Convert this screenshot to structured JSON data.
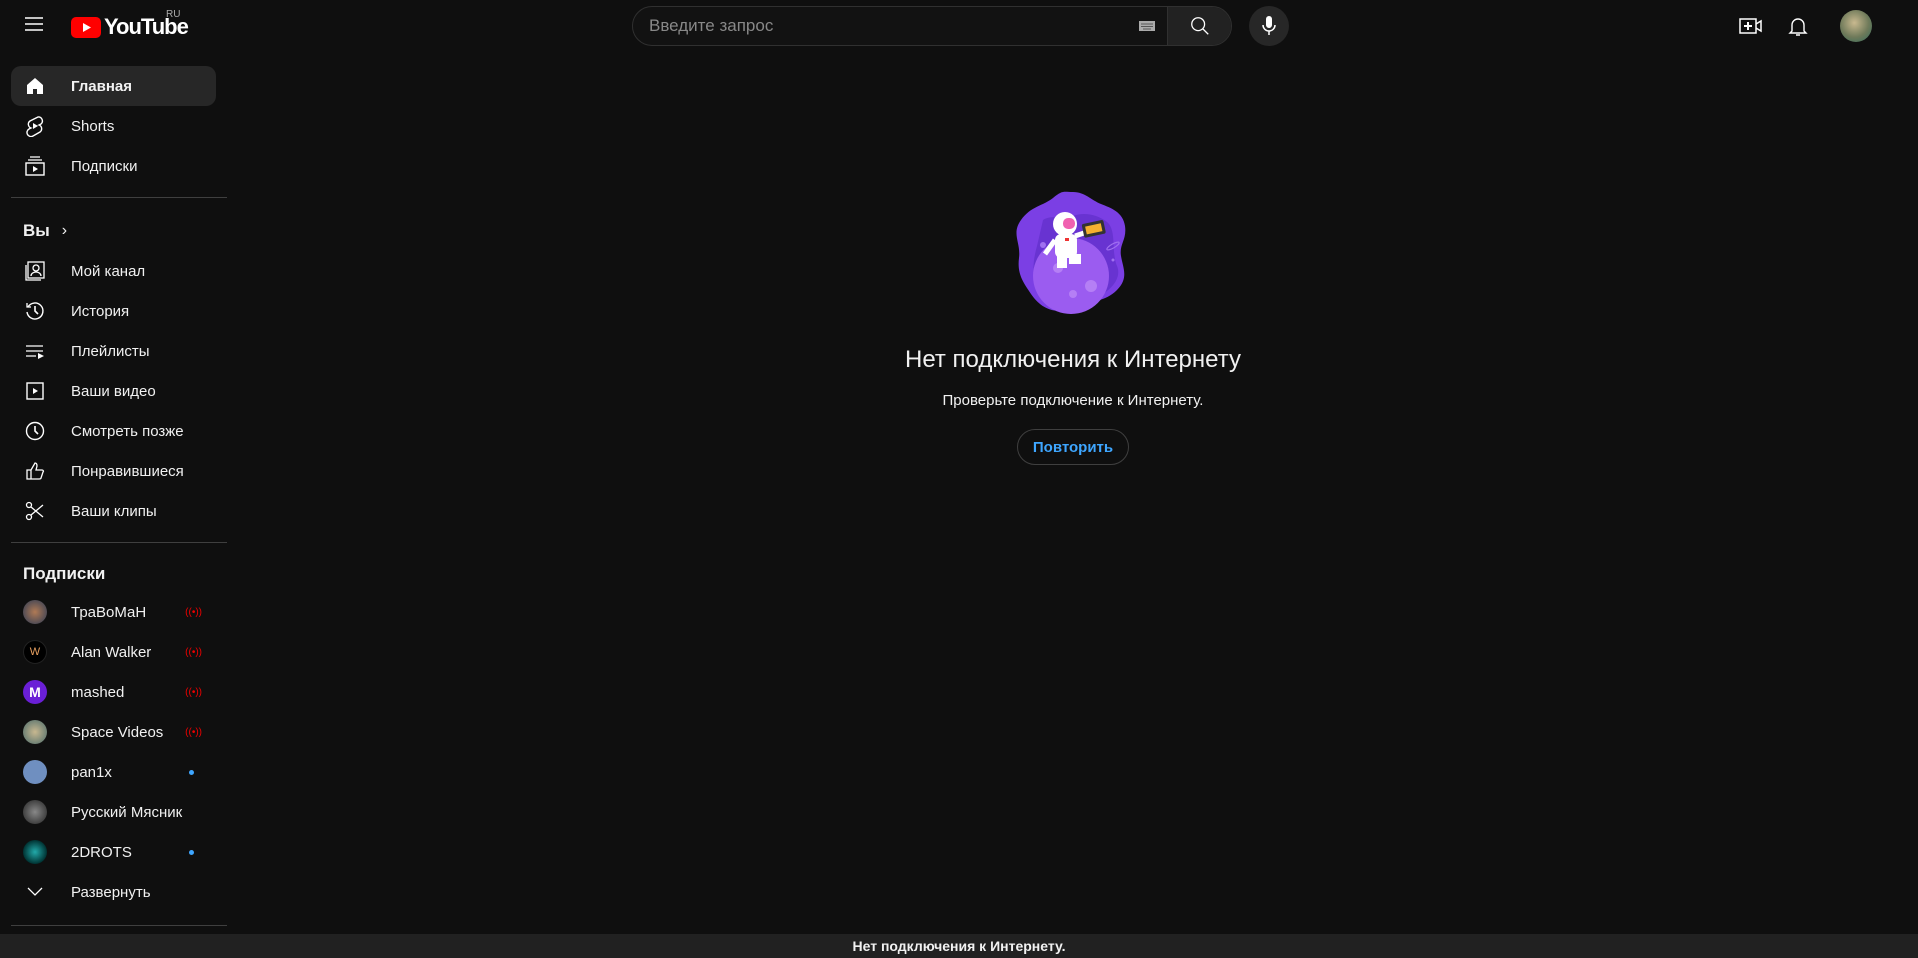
{
  "topbar": {
    "logo_text": "YouTube",
    "region": "RU",
    "search_placeholder": "Введите запрос"
  },
  "sidebar": {
    "main": [
      {
        "label": "Главная",
        "icon": "home-icon",
        "active": true
      },
      {
        "label": "Shorts",
        "icon": "shorts-icon"
      },
      {
        "label": "Подписки",
        "icon": "subscriptions-icon"
      }
    ],
    "you_header": "Вы",
    "you": [
      {
        "label": "Мой канал",
        "icon": "channel-icon"
      },
      {
        "label": "История",
        "icon": "history-icon"
      },
      {
        "label": "Плейлисты",
        "icon": "playlists-icon"
      },
      {
        "label": "Ваши видео",
        "icon": "your-videos-icon"
      },
      {
        "label": "Смотреть позже",
        "icon": "watch-later-icon"
      },
      {
        "label": "Понравившиеся",
        "icon": "like-icon"
      },
      {
        "label": "Ваши клипы",
        "icon": "clips-icon"
      }
    ],
    "subs_header": "Подписки",
    "subscriptions": [
      {
        "name": "ТраВоМаН",
        "status": "live"
      },
      {
        "name": "Alan Walker",
        "status": "live"
      },
      {
        "name": "mashed",
        "status": "live"
      },
      {
        "name": "Space Videos",
        "status": "live"
      },
      {
        "name": "pan1x",
        "status": "new"
      },
      {
        "name": "Русский Мясник",
        "status": ""
      },
      {
        "name": "2DROTS",
        "status": "new"
      }
    ],
    "expand_label": "Развернуть"
  },
  "main": {
    "title": "Нет подключения к Интернету",
    "subtitle": "Проверьте подключение к Интернету.",
    "retry_label": "Повторить"
  },
  "bottom_bar": "Нет подключения к Интернету.",
  "colors": {
    "accent": "#3ea6ff",
    "live": "#ee0000",
    "brand": "#ff0000"
  }
}
